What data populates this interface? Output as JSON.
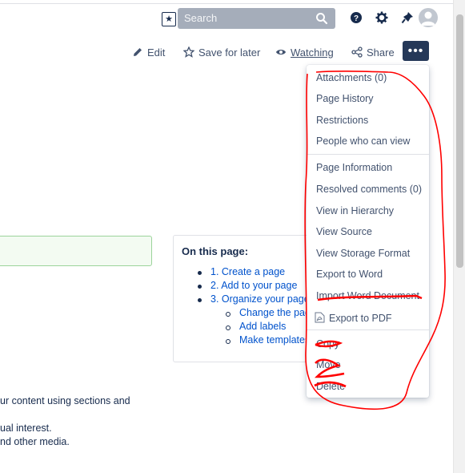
{
  "search": {
    "placeholder": "Search"
  },
  "actions": {
    "edit": "Edit",
    "save_for_later": "Save for later",
    "watching": "Watching",
    "share": "Share",
    "more": "•••"
  },
  "menu": {
    "items": [
      "Attachments (0)",
      "Page History",
      "Restrictions",
      "People who can view",
      "Page Information",
      "Resolved comments (0)",
      "View in Hierarchy",
      "View Source",
      "View Storage Format",
      "Export to Word",
      "Import Word Document",
      "Export to PDF",
      "Copy",
      "Move",
      "Delete"
    ]
  },
  "toc": {
    "heading": "On this page:",
    "items": [
      "1. Create a page",
      "2. Add to your page",
      "3. Organize your page"
    ],
    "subitems": [
      "Change the pag",
      "Add labels",
      "Make templates"
    ]
  },
  "body": {
    "line1": "ur content using sections and",
    "line2": "ual interest.",
    "line3": "nd other media."
  },
  "colors": {
    "accent": "#0052cc",
    "annotation": "#ff0000",
    "more_button": "#253858"
  }
}
